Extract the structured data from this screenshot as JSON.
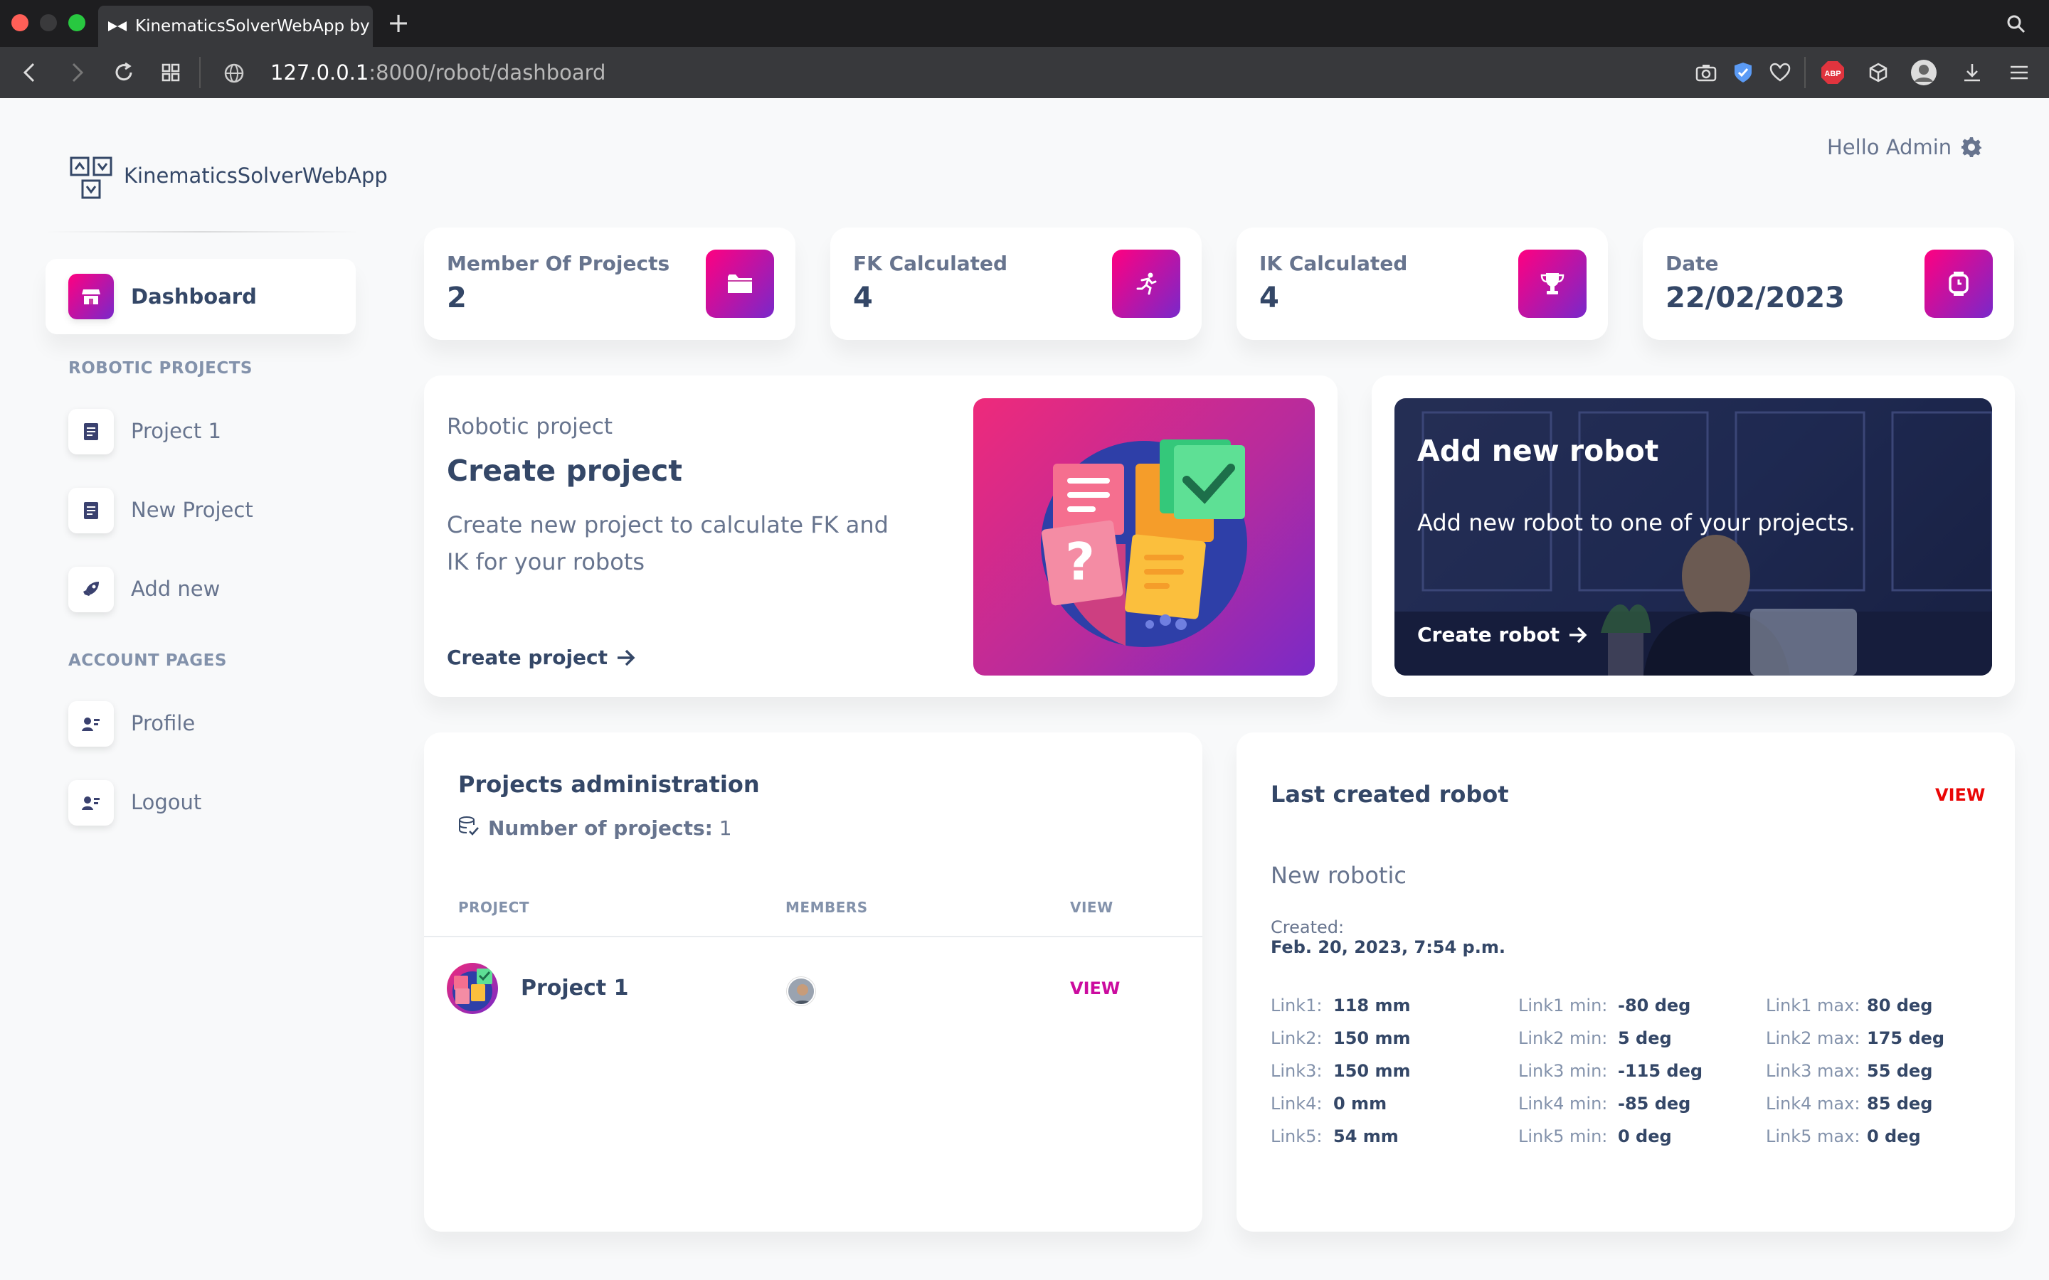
{
  "browser": {
    "tab_title": "KinematicsSolverWebApp by Da",
    "url_host": "127.0.0.1",
    "url_rest": ":8000/robot/dashboard"
  },
  "sidebar": {
    "brand": "KinematicsSolverWebApp",
    "dashboard": "Dashboard",
    "section_projects": "ROBOTIC PROJECTS",
    "project1": "Project 1",
    "new_project": "New Project",
    "add_new": "Add new",
    "section_account": "ACCOUNT PAGES",
    "profile": "Profile",
    "logout": "Logout"
  },
  "header": {
    "greeting": "Hello Admin"
  },
  "stats": [
    {
      "label": "Member Of Projects",
      "value": "2"
    },
    {
      "label": "FK Calculated",
      "value": "4"
    },
    {
      "label": "IK Calculated",
      "value": "4"
    },
    {
      "label": "Date",
      "value": "22/02/2023"
    }
  ],
  "create_card": {
    "overline": "Robotic project",
    "title": "Create project",
    "desc_line1": "Create new project to calculate FK and",
    "desc_line2": "IK for your robots",
    "link": "Create project"
  },
  "robot_card": {
    "title": "Add new robot",
    "desc": "Add new robot to one of your projects.",
    "link": "Create robot"
  },
  "projects_admin": {
    "title": "Projects administration",
    "count_label": "Number of projects:",
    "count": "1",
    "col_project": "PROJECT",
    "col_members": "MEMBERS",
    "col_view": "VIEW",
    "rows": [
      {
        "name": "Project 1",
        "view": "VIEW"
      }
    ]
  },
  "last_robot": {
    "title": "Last created robot",
    "view": "VIEW",
    "name": "New robotic",
    "created_label": "Created:",
    "created_value": "Feb. 20, 2023, 7:54 p.m.",
    "links": [
      {
        "l": "Link1:",
        "v": "118 mm",
        "minl": "Link1 min:",
        "minv": "-80 deg",
        "maxl": "Link1 max:",
        "maxv": "80 deg"
      },
      {
        "l": "Link2:",
        "v": "150 mm",
        "minl": "Link2 min:",
        "minv": "5 deg",
        "maxl": "Link2 max:",
        "maxv": "175 deg"
      },
      {
        "l": "Link3:",
        "v": "150 mm",
        "minl": "Link3 min:",
        "minv": "-115 deg",
        "maxl": "Link3 max:",
        "maxv": "55 deg"
      },
      {
        "l": "Link4:",
        "v": "0 mm",
        "minl": "Link4 min:",
        "minv": "-85 deg",
        "maxl": "Link4 max:",
        "maxv": "85 deg"
      },
      {
        "l": "Link5:",
        "v": "54 mm",
        "minl": "Link5 min:",
        "minv": "0 deg",
        "maxl": "Link5 max:",
        "maxv": "0 deg"
      }
    ]
  },
  "colors": {
    "accent_start": "#7928ca",
    "accent_end": "#ff0080",
    "view_link": "#cb0c9f",
    "view_red": "#ea0606",
    "browser_bg": "#1e1e20"
  }
}
